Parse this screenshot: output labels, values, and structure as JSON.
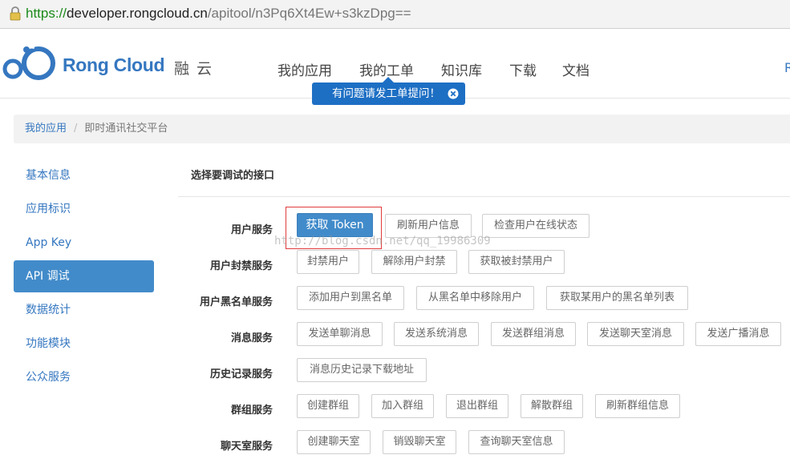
{
  "browser": {
    "url_scheme": "https://",
    "url_host": "developer.rongcloud.cn",
    "url_path": "/apitool/n3Pq6Xt4Ew+s3kzDpg=="
  },
  "header": {
    "logo_text": "Rong Cloud",
    "logo_cn": "融云",
    "nav": [
      "我的应用",
      "我的工单",
      "知识库",
      "下载",
      "文档"
    ],
    "nav_right_partial": "R",
    "tooltip": "有问题请发工单提问！"
  },
  "breadcrumb": {
    "parent": "我的应用",
    "separator": "/",
    "current": "即时通讯社交平台"
  },
  "sidebar": {
    "items": [
      "基本信息",
      "应用标识",
      "App Key",
      "API 调试",
      "数据统计",
      "功能模块",
      "公众服务"
    ],
    "active_index": 3
  },
  "content": {
    "title": "选择要调试的接口",
    "watermark": "http://blog.csdn.net/qq_19986309",
    "rows": [
      {
        "label": "用户服务",
        "buttons": [
          "获取 Token",
          "刷新用户信息",
          "检查用户在线状态"
        ]
      },
      {
        "label": "用户封禁服务",
        "buttons": [
          "封禁用户",
          "解除用户封禁",
          "获取被封禁用户"
        ]
      },
      {
        "label": "用户黑名单服务",
        "buttons": [
          "添加用户到黑名单",
          "从黑名单中移除用户",
          "获取某用户的黑名单列表"
        ]
      },
      {
        "label": "消息服务",
        "buttons": [
          "发送单聊消息",
          "发送系统消息",
          "发送群组消息",
          "发送聊天室消息",
          "发送广播消息"
        ]
      },
      {
        "label": "历史记录服务",
        "buttons": [
          "消息历史记录下载地址"
        ]
      },
      {
        "label": "群组服务",
        "buttons": [
          "创建群组",
          "加入群组",
          "退出群组",
          "解散群组",
          "刷新群组信息"
        ]
      },
      {
        "label": "聊天室服务",
        "buttons": [
          "创建聊天室",
          "销毁聊天室",
          "查询聊天室信息"
        ]
      }
    ]
  },
  "colors": {
    "brand": "#3577c0",
    "primary_button": "#428bca",
    "tooltip": "#1d6fc4",
    "highlight_box": "#e03c3c",
    "url_scheme": "#1a8a1a"
  }
}
